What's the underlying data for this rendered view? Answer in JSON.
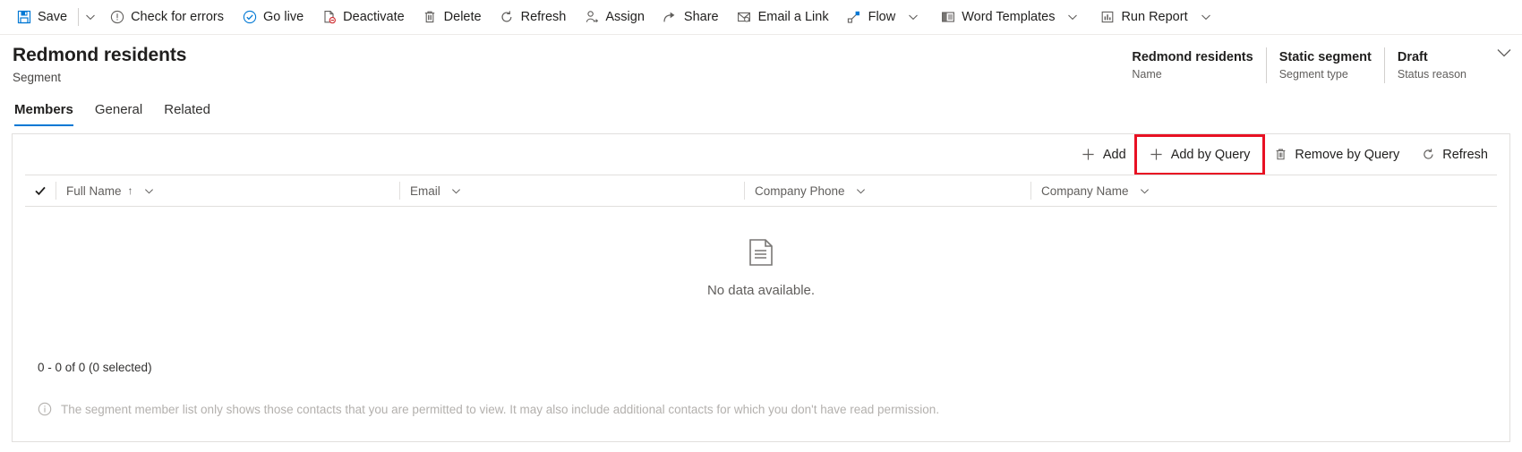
{
  "colors": {
    "accent": "#0078d4",
    "highlight": "#e81123",
    "text": "#201f1e",
    "muted": "#605e5c",
    "faint": "#b3b0ad",
    "border": "#e1dfdd"
  },
  "command_bar": {
    "items": [
      {
        "label": "Save",
        "icon": "save-icon",
        "has_caret": true
      },
      {
        "label": "Check for errors",
        "icon": "error-circle-icon",
        "has_caret": false
      },
      {
        "label": "Go live",
        "icon": "check-circle-icon",
        "has_caret": false
      },
      {
        "label": "Deactivate",
        "icon": "deactivate-page-icon",
        "has_caret": false
      },
      {
        "label": "Delete",
        "icon": "trash-icon",
        "has_caret": false
      },
      {
        "label": "Refresh",
        "icon": "refresh-icon",
        "has_caret": false
      },
      {
        "label": "Assign",
        "icon": "assign-person-icon",
        "has_caret": false
      },
      {
        "label": "Share",
        "icon": "share-icon",
        "has_caret": false
      },
      {
        "label": "Email a Link",
        "icon": "email-link-icon",
        "has_caret": false
      },
      {
        "label": "Flow",
        "icon": "flow-icon",
        "has_caret": true
      },
      {
        "label": "Word Templates",
        "icon": "word-template-icon",
        "has_caret": true
      },
      {
        "label": "Run Report",
        "icon": "run-report-icon",
        "has_caret": true
      }
    ]
  },
  "record_header": {
    "title": "Redmond residents",
    "subtitle": "Segment",
    "fields": [
      {
        "value": "Redmond residents",
        "label": "Name"
      },
      {
        "value": "Static segment",
        "label": "Segment type"
      },
      {
        "value": "Draft",
        "label": "Status reason"
      }
    ],
    "expand_icon": "chevron-down-icon"
  },
  "tabs": [
    {
      "label": "Members",
      "selected": true
    },
    {
      "label": "General",
      "selected": false
    },
    {
      "label": "Related",
      "selected": false
    }
  ],
  "grid": {
    "commands": [
      {
        "label": "Add",
        "icon": "plus-icon",
        "highlighted": false
      },
      {
        "label": "Add by Query",
        "icon": "plus-icon",
        "highlighted": true
      },
      {
        "label": "Remove by Query",
        "icon": "trash-icon",
        "highlighted": false
      },
      {
        "label": "Refresh",
        "icon": "refresh-icon",
        "highlighted": false
      }
    ],
    "columns": [
      {
        "label": "Full Name",
        "sorted": true,
        "sort_direction": "ascending"
      },
      {
        "label": "Email",
        "sorted": false
      },
      {
        "label": "Company Phone",
        "sorted": false
      },
      {
        "label": "Company Name",
        "sorted": false
      }
    ],
    "select_all_icon": "checkmark-icon",
    "empty_state": {
      "icon": "document-icon",
      "message": "No data available."
    },
    "record_count": "0 - 0 of 0 (0 selected)",
    "note": {
      "icon": "info-circle-icon",
      "text": "The segment member list only shows those contacts that you are permitted to view. It may also include additional contacts for which you don't have read permission."
    }
  }
}
